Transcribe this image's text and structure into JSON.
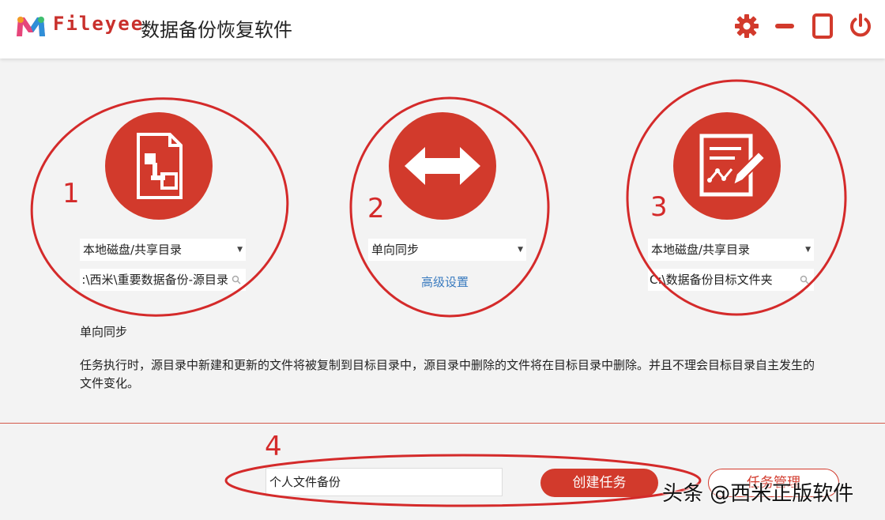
{
  "header": {
    "brand": "Fileyee",
    "title": "数据备份恢复软件",
    "accent_color": "#c9302c",
    "buttons": [
      "gear-icon",
      "minimize-icon",
      "maximize-icon",
      "power-icon"
    ]
  },
  "source": {
    "icon": "file-tree-icon",
    "type_label": "本地磁盘/共享目录",
    "path": "D:\\西米\\重要数据备份-源目录"
  },
  "mode": {
    "icon": "double-arrow-icon",
    "selected": "单向同步",
    "advanced_link": "高级设置"
  },
  "target": {
    "icon": "edit-document-icon",
    "type_label": "本地磁盘/共享目录",
    "path": "C:\\数据备份目标文件夹"
  },
  "description": {
    "title": "单向同步",
    "text": "任务执行时，源目录中新建和更新的文件将被复制到目标目录中，源目录中删除的文件将在目标目录中删除。并且不理会目标目录自主发生的文件变化。"
  },
  "footer": {
    "task_name_value": "个人文件备份",
    "create_button": "创建任务",
    "manage_button": "任务管理"
  },
  "annotations": {
    "numbers": [
      "1",
      "2",
      "3",
      "4"
    ],
    "color": "#d42a2a"
  },
  "watermark": "头条 @西米正版软件"
}
